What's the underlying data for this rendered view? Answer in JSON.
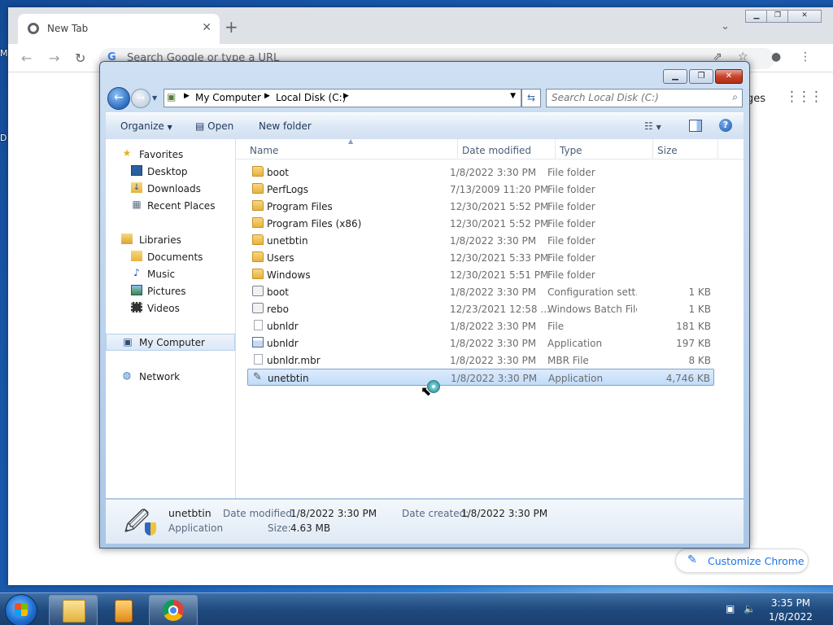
{
  "desktop": {
    "icon_letter_1": "M",
    "icon_letter_2": "D"
  },
  "chrome": {
    "tab_title": "New Tab",
    "omnibox_placeholder": "Search Google or type a URL",
    "images_link": "ges",
    "customize_label": "Customize Chrome"
  },
  "explorer": {
    "address": {
      "crumbs": [
        "My Computer",
        "Local Disk (C:)"
      ]
    },
    "search_placeholder": "Search Local Disk (C:)",
    "commands": {
      "organize": "Organize",
      "open": "Open",
      "new_folder": "New folder"
    },
    "nav": {
      "favorites": "Favorites",
      "desktop": "Desktop",
      "downloads": "Downloads",
      "recent_places": "Recent Places",
      "libraries": "Libraries",
      "documents": "Documents",
      "music": "Music",
      "pictures": "Pictures",
      "videos": "Videos",
      "my_computer": "My Computer",
      "network": "Network"
    },
    "columns": {
      "name": "Name",
      "date": "Date modified",
      "type": "Type",
      "size": "Size"
    },
    "files": [
      {
        "name": "boot",
        "date": "1/8/2022 3:30 PM",
        "type": "File folder",
        "size": "",
        "icon": "folder-icon"
      },
      {
        "name": "PerfLogs",
        "date": "7/13/2009 11:20 PM",
        "type": "File folder",
        "size": "",
        "icon": "folder-icon"
      },
      {
        "name": "Program Files",
        "date": "12/30/2021 5:52 PM",
        "type": "File folder",
        "size": "",
        "icon": "folder-icon"
      },
      {
        "name": "Program Files (x86)",
        "date": "12/30/2021 5:52 PM",
        "type": "File folder",
        "size": "",
        "icon": "folder-icon"
      },
      {
        "name": "unetbtin",
        "date": "1/8/2022 3:30 PM",
        "type": "File folder",
        "size": "",
        "icon": "folder-icon"
      },
      {
        "name": "Users",
        "date": "12/30/2021 5:33 PM",
        "type": "File folder",
        "size": "",
        "icon": "folder-icon"
      },
      {
        "name": "Windows",
        "date": "12/30/2021 5:51 PM",
        "type": "File folder",
        "size": "",
        "icon": "folder-icon"
      },
      {
        "name": "boot",
        "date": "1/8/2022 3:30 PM",
        "type": "Configuration sett...",
        "size": "1 KB",
        "icon": "config-file-icon"
      },
      {
        "name": "rebo",
        "date": "12/23/2021 12:58 ...",
        "type": "Windows Batch File",
        "size": "1 KB",
        "icon": "batch-file-icon"
      },
      {
        "name": "ubnldr",
        "date": "1/8/2022 3:30 PM",
        "type": "File",
        "size": "181 KB",
        "icon": "file-icon"
      },
      {
        "name": "ubnldr",
        "date": "1/8/2022 3:30 PM",
        "type": "Application",
        "size": "197 KB",
        "icon": "application-icon"
      },
      {
        "name": "ubnldr.mbr",
        "date": "1/8/2022 3:30 PM",
        "type": "MBR File",
        "size": "8 KB",
        "icon": "file-icon"
      },
      {
        "name": "unetbtin",
        "date": "1/8/2022 3:30 PM",
        "type": "Application",
        "size": "4,746 KB",
        "icon": "usb-drive-icon",
        "selected": true
      }
    ],
    "details": {
      "name": "unetbtin",
      "kind": "Application",
      "date_modified_label": "Date modified:",
      "date_modified": "1/8/2022 3:30 PM",
      "date_created_label": "Date created:",
      "date_created": "1/8/2022 3:30 PM",
      "size_label": "Size:",
      "size": "4.63 MB"
    }
  },
  "taskbar": {
    "time": "3:35 PM",
    "date": "1/8/2022"
  }
}
